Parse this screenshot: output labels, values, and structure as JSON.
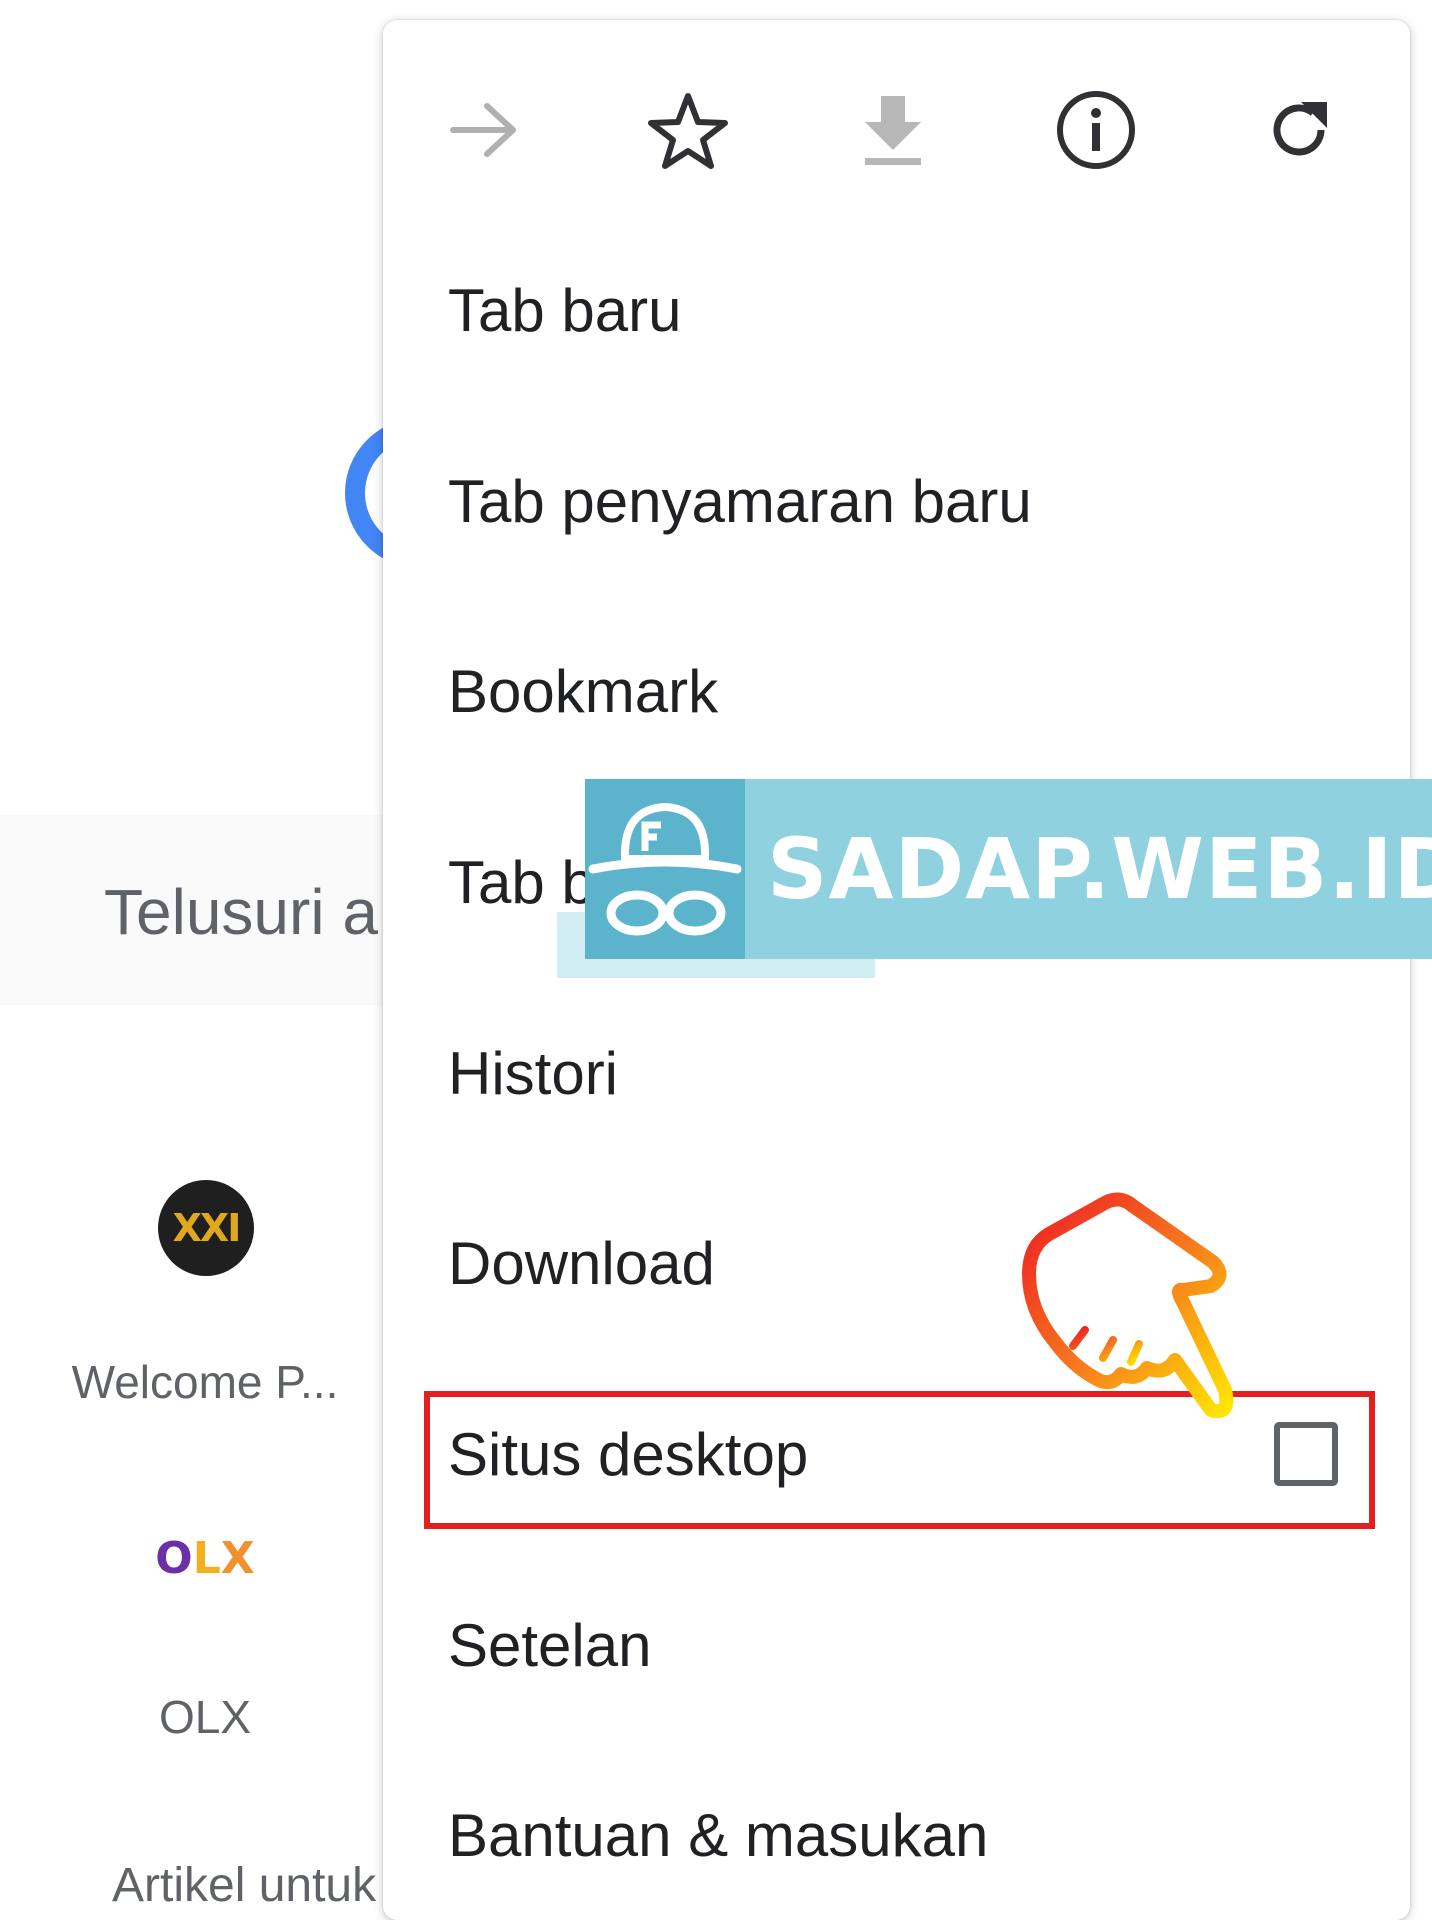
{
  "background": {
    "search_text": "Telusuri a",
    "shortcuts": [
      {
        "icon_text": "XXI",
        "label": "Welcome P..."
      },
      {
        "icon_text": "OLX",
        "label": "OLX"
      }
    ],
    "article_text": "Artikel untuk"
  },
  "menu": {
    "toolbar": [
      {
        "icon": "forward-arrow-icon"
      },
      {
        "icon": "star-icon"
      },
      {
        "icon": "download-icon"
      },
      {
        "icon": "info-icon"
      },
      {
        "icon": "refresh-icon"
      }
    ],
    "items": [
      {
        "label": "Tab baru"
      },
      {
        "label": "Tab penyamaran baru"
      },
      {
        "label": "Bookmark"
      },
      {
        "label": "Tab b"
      },
      {
        "label": "Histori"
      },
      {
        "label": "Download"
      },
      {
        "label": "Situs desktop",
        "checkbox": true,
        "checked": false
      },
      {
        "label": "Setelan"
      },
      {
        "label": "Bantuan & masukan"
      }
    ]
  },
  "watermark": {
    "text": "SADAP.WEB.ID"
  },
  "colors": {
    "highlight": "#e41f1f",
    "watermark_bg": "#8fd1df",
    "watermark_icon_bg": "#5bb3cc",
    "logo_blue": "#4285f4"
  }
}
